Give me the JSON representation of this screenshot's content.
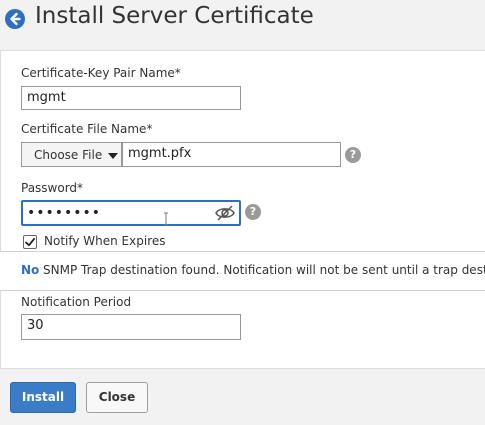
{
  "header": {
    "title": "Install Server Certificate",
    "back_icon": "arrow-left-circle-icon"
  },
  "form": {
    "certkey_label": "Certificate-Key Pair Name*",
    "certkey_value": "mgmt",
    "certfile_label": "Certificate File Name*",
    "choose_file_label": "Choose File",
    "certfile_value": "mgmt.pfx",
    "password_label": "Password*",
    "password_mask": "••••••••",
    "notify_label": "Notify When Expires",
    "notify_checked": true,
    "notice_no": "No",
    "notice_message": "SNMP Trap destination found. Notification will not be sent until a trap destination is configured.",
    "period_label": "Notification Period",
    "period_value": "30"
  },
  "footer": {
    "install_label": "Install",
    "close_label": "Close"
  },
  "colors": {
    "accent": "#2f6fc1",
    "primary_button": "#3a7cc8"
  }
}
